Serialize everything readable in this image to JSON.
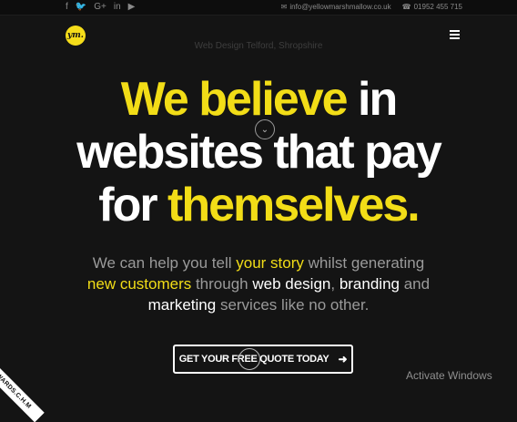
{
  "topbar": {
    "social": [
      {
        "icon": "facebook-icon",
        "glyph": "f"
      },
      {
        "icon": "twitter-icon",
        "glyph": "🐦"
      },
      {
        "icon": "google-plus-icon",
        "glyph": "G+"
      },
      {
        "icon": "linkedin-icon",
        "glyph": "in"
      },
      {
        "icon": "youtube-icon",
        "glyph": "▶"
      }
    ],
    "email": "info@yellowmarshmallow.co.uk",
    "phone": "01952 455 715"
  },
  "logo_text": "ym.",
  "tagline": "Web Design Telford, Shropshire",
  "headline": {
    "line1_yellow": "We believe",
    "line1_white": " in",
    "line2": "websites that pay",
    "line3_white": "for ",
    "line3_yellow": "themselves."
  },
  "sub": {
    "p1": "We can help you tell ",
    "story": "your story",
    "p2": " whilst generating",
    "new_customers": "new customers",
    "p3": " through ",
    "web_design": "web design",
    "p4": ", ",
    "branding": "branding",
    "p5": " and",
    "marketing": "marketing",
    "p6": " services like no other."
  },
  "cta_label": "GET YOUR FREE QUOTE TODAY",
  "cta_arrow": "➜",
  "scroll_glyph": "⌄",
  "activate_windows": "Activate Windows",
  "ribbon_text": "AWWWARDS.C.H.M",
  "colors": {
    "accent": "#f2dd17",
    "background": "#141414"
  }
}
